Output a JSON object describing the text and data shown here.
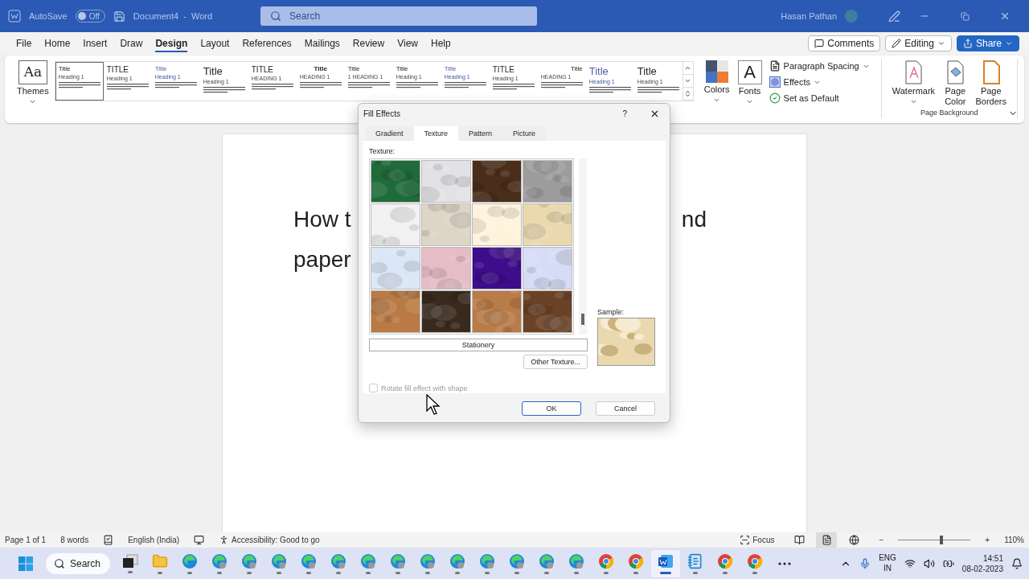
{
  "titlebar": {
    "autosave_label": "AutoSave",
    "autosave": {
      "on": false,
      "label": "Off"
    },
    "document_title": "Document4  -  Word",
    "search": {
      "placeholder": "Search"
    },
    "user": "Hasan Pathan"
  },
  "menu_tabs": [
    {
      "label": "File",
      "selected": false
    },
    {
      "label": "Home",
      "selected": false
    },
    {
      "label": "Insert",
      "selected": false
    },
    {
      "label": "Draw",
      "selected": false
    },
    {
      "label": "Design",
      "selected": true
    },
    {
      "label": "Layout",
      "selected": false
    },
    {
      "label": "References",
      "selected": false
    },
    {
      "label": "Mailings",
      "selected": false
    },
    {
      "label": "Review",
      "selected": false
    },
    {
      "label": "View",
      "selected": false
    },
    {
      "label": "Help",
      "selected": false
    }
  ],
  "actions": {
    "comments": "Comments",
    "editing": "Editing",
    "share": "Share"
  },
  "ribbon": {
    "themes_glyph": "Aa",
    "themes": "Themes",
    "colors": "Colors",
    "fonts_glyph": "A",
    "fonts": "Fonts",
    "paragraph_spacing": "Paragraph Spacing",
    "effects": "Effects",
    "set_default": "Set as Default",
    "watermark": "Watermark",
    "page_color": "Page Color",
    "page_borders": "Page Borders",
    "group_label": "Page Background"
  },
  "style_gallery": [
    {
      "title": "Title",
      "heading": "Heading 1",
      "kind": "small",
      "selected": true
    },
    {
      "title": "TITLE",
      "heading": "Heading 1",
      "kind": "caps",
      "selected": false
    },
    {
      "title": "Title",
      "heading": "Heading 1",
      "kind": "accent",
      "selected": false
    },
    {
      "title": "Title",
      "heading": "Heading 1",
      "kind": "large",
      "selected": false
    },
    {
      "title": "TITLE",
      "heading": "HEADING 1",
      "kind": "caps",
      "selected": false
    },
    {
      "title": "Title",
      "heading": "HEADING 1",
      "kind": "center",
      "selected": false
    },
    {
      "title": "Title",
      "heading": "1 HEADING 1",
      "kind": "small",
      "selected": false
    },
    {
      "title": "Title",
      "heading": "Heading 1",
      "kind": "small",
      "selected": false
    },
    {
      "title": "Title",
      "heading": "Heading 1",
      "kind": "accent",
      "selected": false
    },
    {
      "title": "TITLE",
      "heading": "Heading 1",
      "kind": "caps",
      "selected": false
    },
    {
      "title": "Title",
      "heading": "HEADING 1",
      "kind": "right",
      "selected": false
    },
    {
      "title": "Title",
      "heading": "Heading 1",
      "kind": "accent-large",
      "selected": false
    },
    {
      "title": "Title",
      "heading": "Heading 1",
      "kind": "large",
      "selected": false
    }
  ],
  "document": {
    "line_1_start": "How t",
    "line_1_end": "nd",
    "line_2": "paper"
  },
  "dialog": {
    "title": "Fill Effects",
    "help": "?",
    "tabs": [
      {
        "label": "Gradient",
        "selected": false
      },
      {
        "label": "Texture",
        "selected": true
      },
      {
        "label": "Pattern",
        "selected": false
      },
      {
        "label": "Picture",
        "selected": false
      }
    ],
    "texture_label": "Texture:",
    "textures": [
      {
        "color": "#1f6b3a"
      },
      {
        "color": "#e2e2e5"
      },
      {
        "color": "#4a2e1a"
      },
      {
        "color": "#9c9c9c"
      },
      {
        "color": "#f1f1f1"
      },
      {
        "color": "#ddd5c6"
      },
      {
        "color": "#fff3dc"
      },
      {
        "color": "#ead9ae"
      },
      {
        "color": "#dbe7f7"
      },
      {
        "color": "#e6bcc6"
      },
      {
        "color": "#3d0d8c"
      },
      {
        "color": "#d6dcf6"
      },
      {
        "color": "#b97a45"
      },
      {
        "color": "#3a2a1e"
      },
      {
        "color": "#b97b47"
      },
      {
        "color": "#6b4226"
      }
    ],
    "texture_name": "Stationery",
    "other_texture": "Other Texture...",
    "sample_label": "Sample:",
    "rotate": {
      "label": "Rotate fill effect with shape",
      "checked": false,
      "disabled": true
    },
    "ok": "OK",
    "cancel": "Cancel"
  },
  "status_bar": {
    "page": "Page 1 of 1",
    "words": "8 words",
    "language": "English (India)",
    "accessibility": "Accessibility: Good to go",
    "focus": "Focus",
    "views": [
      {
        "kind": "read",
        "selected": false
      },
      {
        "kind": "print",
        "selected": true
      },
      {
        "kind": "web",
        "selected": false
      }
    ],
    "zoom_out": "−",
    "zoom_in": "+",
    "zoom": {
      "level": 0.6
    },
    "zoom_label": "110%"
  },
  "taskbar": {
    "search": "Search",
    "apps": [
      {
        "kind": "taskview",
        "active": false
      },
      {
        "kind": "folder",
        "active": false
      },
      {
        "kind": "edge",
        "active": false
      },
      {
        "kind": "edge-profile",
        "active": false
      },
      {
        "kind": "edge-profile",
        "active": false
      },
      {
        "kind": "edge-profile",
        "active": false
      },
      {
        "kind": "edge-profile",
        "active": false
      },
      {
        "kind": "edge-profile",
        "active": false
      },
      {
        "kind": "edge-profile",
        "active": false
      },
      {
        "kind": "edge-profile",
        "active": false
      },
      {
        "kind": "edge-profile",
        "active": false
      },
      {
        "kind": "edge-profile",
        "active": false
      },
      {
        "kind": "edge-profile",
        "active": false
      },
      {
        "kind": "edge-profile",
        "active": false
      },
      {
        "kind": "edge-profile",
        "active": false
      },
      {
        "kind": "edge-profile",
        "active": false
      },
      {
        "kind": "chrome",
        "active": false
      },
      {
        "kind": "chrome",
        "active": false
      },
      {
        "kind": "word",
        "active": true
      },
      {
        "kind": "notepad",
        "active": false
      },
      {
        "kind": "chrome",
        "active": false
      },
      {
        "kind": "chrome",
        "active": false
      },
      {
        "kind": "more",
        "active": false
      }
    ],
    "language_1": "ENG",
    "language_2": "IN",
    "time": "14:51",
    "date": "08-02-2023"
  }
}
